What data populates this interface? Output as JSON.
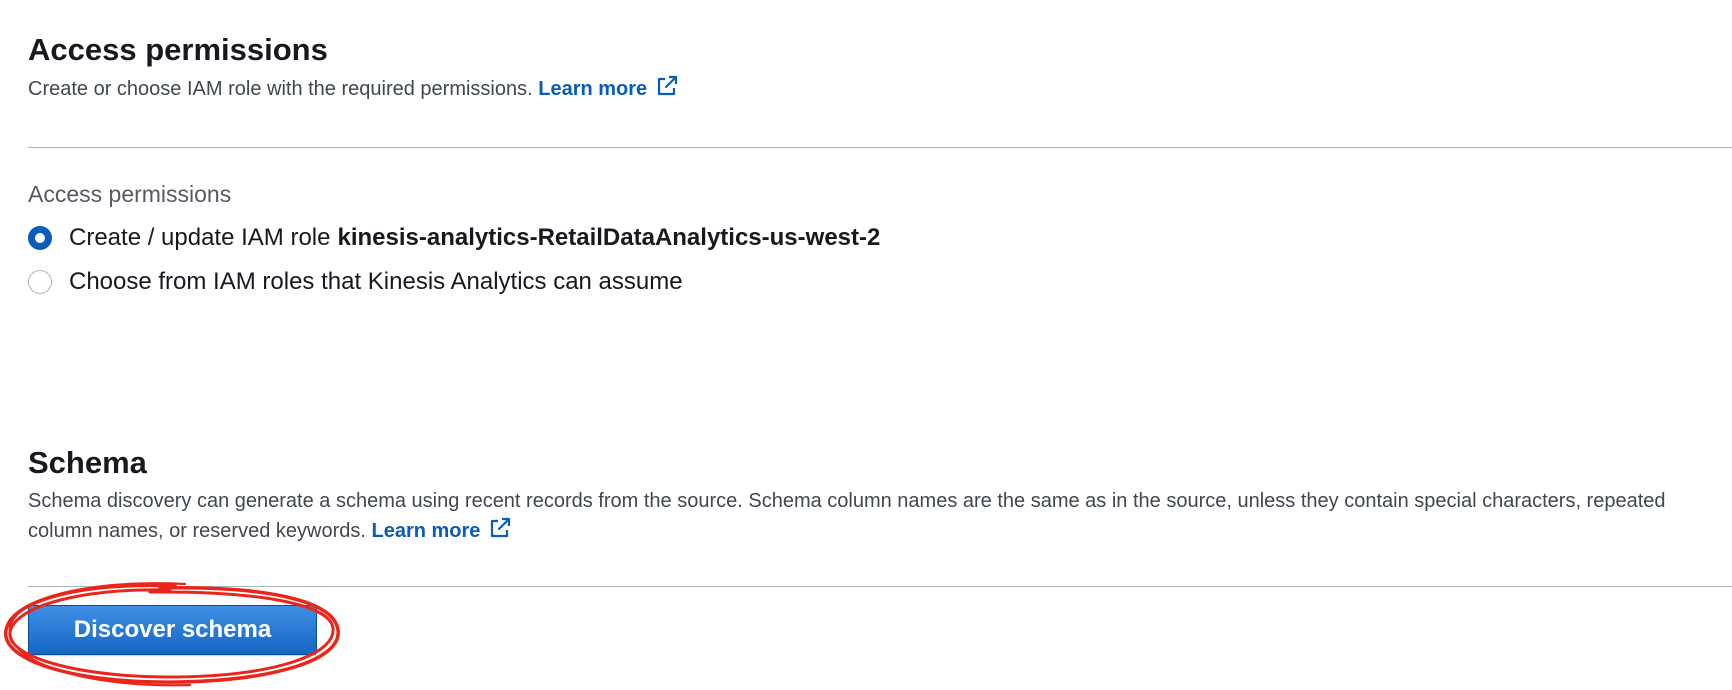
{
  "access_permissions": {
    "title": "Access permissions",
    "description": "Create or choose IAM role with the required permissions.",
    "learn_more": "Learn more",
    "field_label": "Access permissions",
    "options": [
      {
        "label": "Create / update IAM role",
        "role_name": "kinesis-analytics-RetailDataAnalytics-us-west-2",
        "selected": true
      },
      {
        "label": "Choose from IAM roles that Kinesis Analytics can assume",
        "selected": false
      }
    ]
  },
  "schema": {
    "title": "Schema",
    "description": "Schema discovery can generate a schema using recent records from the source. Schema column names are the same as in the source, unless they contain special characters, repeated column names, or reserved keywords.",
    "learn_more": "Learn more",
    "discover_button": "Discover schema"
  },
  "colors": {
    "link": "#0a5cb8",
    "primary_button": "#1466c4",
    "annotation": "#e8261b"
  },
  "icons": {
    "external_link": "external-link-icon"
  }
}
